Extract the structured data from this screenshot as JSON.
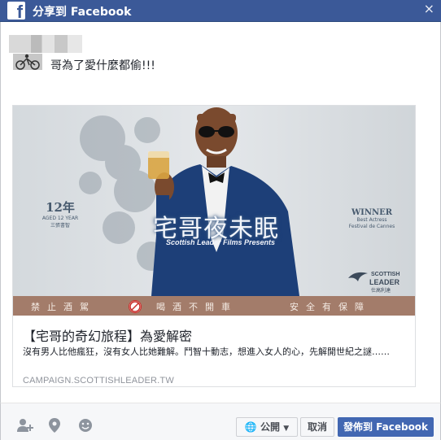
{
  "window": {
    "title": "分享到 Facebook",
    "close_glyph": "×",
    "logo_letter": "f"
  },
  "post": {
    "message": "哥為了愛什麼都偷!!!"
  },
  "link_preview": {
    "image": {
      "movie_title": "宅哥夜未眠",
      "presents": "Scottish Leader Films Presents",
      "badge_left_main": "12年",
      "badge_left_sub1": "AGED 12 YEAR",
      "badge_left_sub2": "三張書智",
      "badge_right_main": "WINNER",
      "badge_right_sub1": "Best Actress",
      "badge_right_sub2": "Festival de Cannes",
      "brand_line1": "SCOTTISH",
      "brand_line2": "LEADER",
      "brand_line3": "仕高利達",
      "warning_left": "禁止酒駕",
      "warning_mid": "喝酒不開車",
      "warning_right": "安全有保障"
    },
    "title": "【宅哥的奇幻旅程】為愛解密",
    "description": "沒有男人比他瘋狂，沒有女人比她難解。鬥智十動志，想進入女人的心，先解開世紀之謎……",
    "domain": "CAMPAIGN.SCOTTISHLEADER.TW"
  },
  "footer": {
    "icons": [
      "tag-friends-icon",
      "location-icon",
      "emoji-icon"
    ],
    "privacy_label": "公開",
    "cancel_label": "取消",
    "post_label": "發佈到 Facebook"
  },
  "colors": {
    "brand_blue": "#3b5998",
    "post_button": "#4267b2",
    "warning_bar": "#a37c6a"
  }
}
